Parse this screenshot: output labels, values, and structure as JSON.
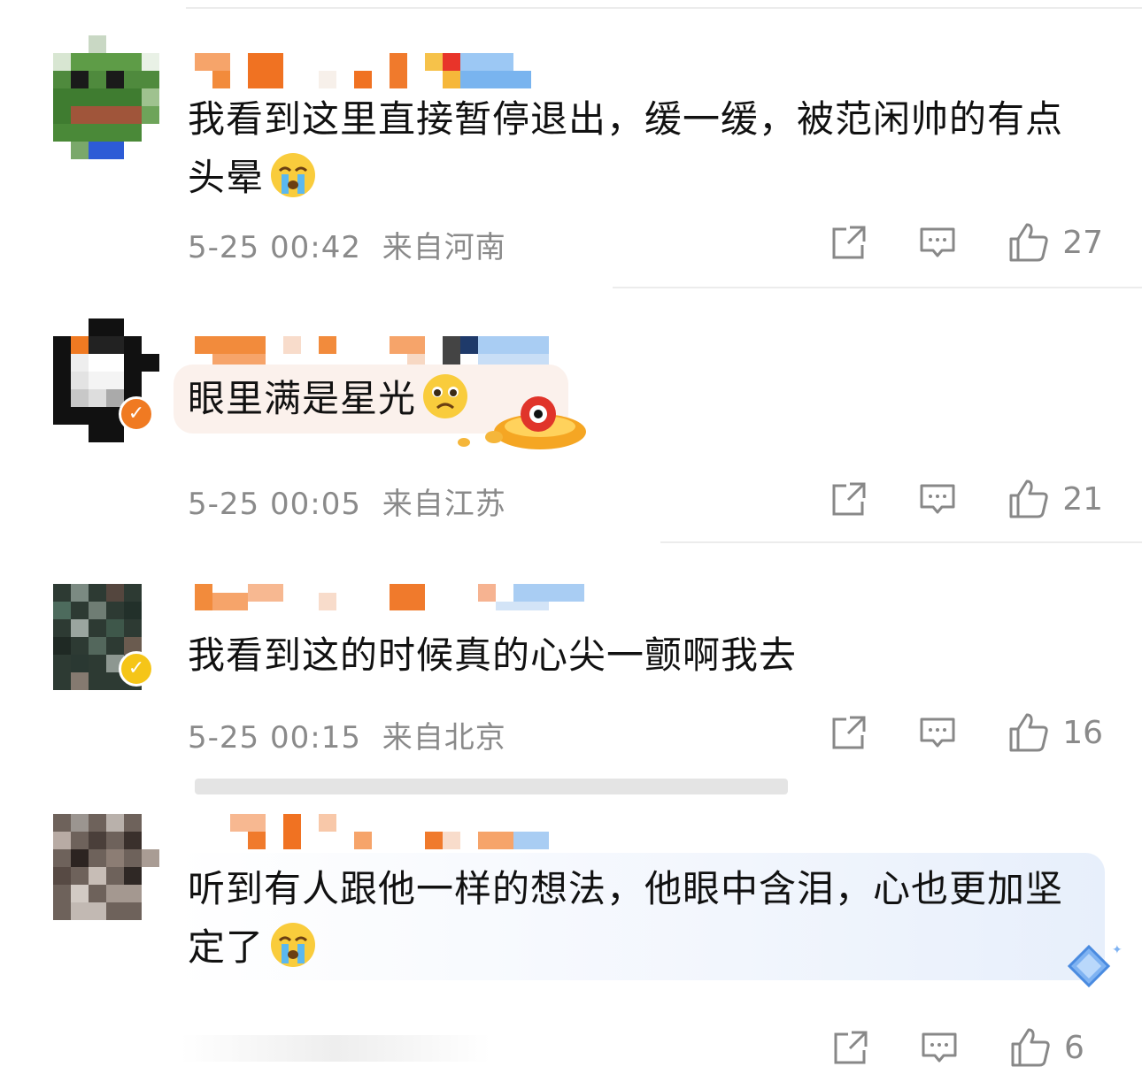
{
  "comments": [
    {
      "text": "我看到这里直接暂停退出，缓一缓，被范闲帅的有点头晕",
      "emoji": "crying-emoji",
      "time": "5-25 00:42",
      "location": "来自河南",
      "likes": "27"
    },
    {
      "text": "眼里满是星光",
      "emoji": "pleading-emoji",
      "time": "5-25 00:05",
      "location": "来自江苏",
      "likes": "21"
    },
    {
      "text": "我看到这的时候真的心尖一颤啊我去",
      "emoji": "",
      "time": "5-25 00:15",
      "location": "来自北京",
      "likes": "16"
    },
    {
      "text": "听到有人跟他一样的想法，他眼中含泪，心也更加坚定了",
      "emoji": "crying-emoji",
      "time": "",
      "location": "",
      "likes": "6"
    }
  ],
  "icons": {
    "share": "share-icon",
    "reply": "comment-icon",
    "like": "thumbs-up-icon"
  },
  "colors": {
    "text": "#111111",
    "meta": "#8a8a8a",
    "divider": "#ececec",
    "verified_orange": "#f07a22",
    "verified_gold": "#f5c518"
  }
}
